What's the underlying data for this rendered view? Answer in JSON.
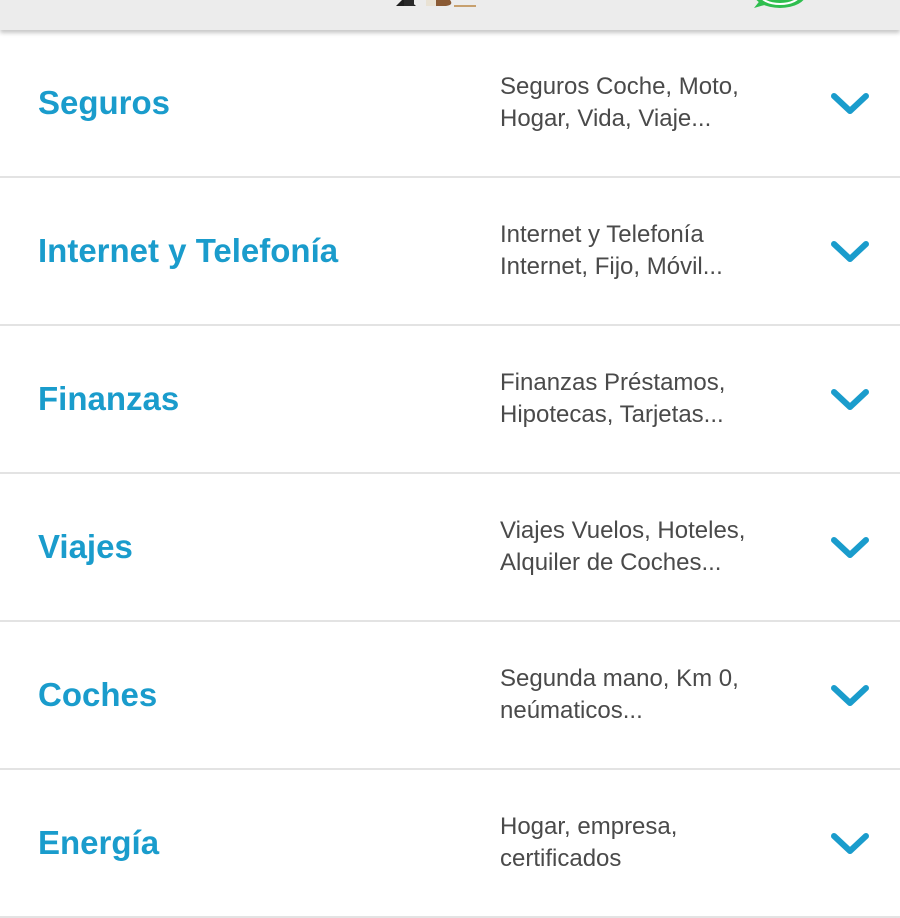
{
  "header": {
    "logo_icon": "mascot-logo",
    "chat_icon": "whatsapp-icon"
  },
  "menu": {
    "items": [
      {
        "title": "Seguros",
        "desc_line1": "Seguros Coche, Moto,",
        "desc_line2": "Hogar, Vida, Viaje...",
        "icon": "chevron-down-icon"
      },
      {
        "title": "Internet y Telefonía",
        "desc_line1": "Internet y Telefonía",
        "desc_line2": "Internet, Fijo, Móvil...",
        "icon": "chevron-down-icon"
      },
      {
        "title": "Finanzas",
        "desc_line1": "Finanzas Préstamos,",
        "desc_line2": "Hipotecas, Tarjetas...",
        "icon": "chevron-down-icon"
      },
      {
        "title": "Viajes",
        "desc_line1": "Viajes Vuelos, Hoteles,",
        "desc_line2": "Alquiler de Coches...",
        "icon": "chevron-down-icon"
      },
      {
        "title": "Coches",
        "desc_line1": "Segunda mano, Km 0,",
        "desc_line2": "neúmaticos...",
        "icon": "chevron-down-icon"
      },
      {
        "title": "Energía",
        "desc_line1": "Hogar, empresa,",
        "desc_line2": "certificados",
        "icon": "chevron-down-icon"
      }
    ]
  },
  "colors": {
    "accent": "#1a9ccc",
    "text": "#4a4a4a",
    "divider": "#e3e3e3",
    "header_bg": "#ececec"
  }
}
